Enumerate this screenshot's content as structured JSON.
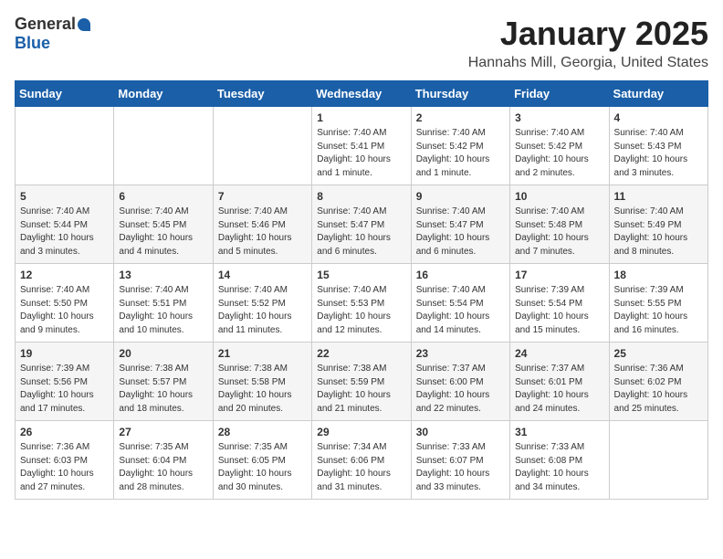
{
  "header": {
    "logo_general": "General",
    "logo_blue": "Blue",
    "title": "January 2025",
    "subtitle": "Hannahs Mill, Georgia, United States"
  },
  "days_of_week": [
    "Sunday",
    "Monday",
    "Tuesday",
    "Wednesday",
    "Thursday",
    "Friday",
    "Saturday"
  ],
  "weeks": [
    [
      {
        "day": "",
        "info": ""
      },
      {
        "day": "",
        "info": ""
      },
      {
        "day": "",
        "info": ""
      },
      {
        "day": "1",
        "info": "Sunrise: 7:40 AM\nSunset: 5:41 PM\nDaylight: 10 hours\nand 1 minute."
      },
      {
        "day": "2",
        "info": "Sunrise: 7:40 AM\nSunset: 5:42 PM\nDaylight: 10 hours\nand 1 minute."
      },
      {
        "day": "3",
        "info": "Sunrise: 7:40 AM\nSunset: 5:42 PM\nDaylight: 10 hours\nand 2 minutes."
      },
      {
        "day": "4",
        "info": "Sunrise: 7:40 AM\nSunset: 5:43 PM\nDaylight: 10 hours\nand 3 minutes."
      }
    ],
    [
      {
        "day": "5",
        "info": "Sunrise: 7:40 AM\nSunset: 5:44 PM\nDaylight: 10 hours\nand 3 minutes."
      },
      {
        "day": "6",
        "info": "Sunrise: 7:40 AM\nSunset: 5:45 PM\nDaylight: 10 hours\nand 4 minutes."
      },
      {
        "day": "7",
        "info": "Sunrise: 7:40 AM\nSunset: 5:46 PM\nDaylight: 10 hours\nand 5 minutes."
      },
      {
        "day": "8",
        "info": "Sunrise: 7:40 AM\nSunset: 5:47 PM\nDaylight: 10 hours\nand 6 minutes."
      },
      {
        "day": "9",
        "info": "Sunrise: 7:40 AM\nSunset: 5:47 PM\nDaylight: 10 hours\nand 6 minutes."
      },
      {
        "day": "10",
        "info": "Sunrise: 7:40 AM\nSunset: 5:48 PM\nDaylight: 10 hours\nand 7 minutes."
      },
      {
        "day": "11",
        "info": "Sunrise: 7:40 AM\nSunset: 5:49 PM\nDaylight: 10 hours\nand 8 minutes."
      }
    ],
    [
      {
        "day": "12",
        "info": "Sunrise: 7:40 AM\nSunset: 5:50 PM\nDaylight: 10 hours\nand 9 minutes."
      },
      {
        "day": "13",
        "info": "Sunrise: 7:40 AM\nSunset: 5:51 PM\nDaylight: 10 hours\nand 10 minutes."
      },
      {
        "day": "14",
        "info": "Sunrise: 7:40 AM\nSunset: 5:52 PM\nDaylight: 10 hours\nand 11 minutes."
      },
      {
        "day": "15",
        "info": "Sunrise: 7:40 AM\nSunset: 5:53 PM\nDaylight: 10 hours\nand 12 minutes."
      },
      {
        "day": "16",
        "info": "Sunrise: 7:40 AM\nSunset: 5:54 PM\nDaylight: 10 hours\nand 14 minutes."
      },
      {
        "day": "17",
        "info": "Sunrise: 7:39 AM\nSunset: 5:54 PM\nDaylight: 10 hours\nand 15 minutes."
      },
      {
        "day": "18",
        "info": "Sunrise: 7:39 AM\nSunset: 5:55 PM\nDaylight: 10 hours\nand 16 minutes."
      }
    ],
    [
      {
        "day": "19",
        "info": "Sunrise: 7:39 AM\nSunset: 5:56 PM\nDaylight: 10 hours\nand 17 minutes."
      },
      {
        "day": "20",
        "info": "Sunrise: 7:38 AM\nSunset: 5:57 PM\nDaylight: 10 hours\nand 18 minutes."
      },
      {
        "day": "21",
        "info": "Sunrise: 7:38 AM\nSunset: 5:58 PM\nDaylight: 10 hours\nand 20 minutes."
      },
      {
        "day": "22",
        "info": "Sunrise: 7:38 AM\nSunset: 5:59 PM\nDaylight: 10 hours\nand 21 minutes."
      },
      {
        "day": "23",
        "info": "Sunrise: 7:37 AM\nSunset: 6:00 PM\nDaylight: 10 hours\nand 22 minutes."
      },
      {
        "day": "24",
        "info": "Sunrise: 7:37 AM\nSunset: 6:01 PM\nDaylight: 10 hours\nand 24 minutes."
      },
      {
        "day": "25",
        "info": "Sunrise: 7:36 AM\nSunset: 6:02 PM\nDaylight: 10 hours\nand 25 minutes."
      }
    ],
    [
      {
        "day": "26",
        "info": "Sunrise: 7:36 AM\nSunset: 6:03 PM\nDaylight: 10 hours\nand 27 minutes."
      },
      {
        "day": "27",
        "info": "Sunrise: 7:35 AM\nSunset: 6:04 PM\nDaylight: 10 hours\nand 28 minutes."
      },
      {
        "day": "28",
        "info": "Sunrise: 7:35 AM\nSunset: 6:05 PM\nDaylight: 10 hours\nand 30 minutes."
      },
      {
        "day": "29",
        "info": "Sunrise: 7:34 AM\nSunset: 6:06 PM\nDaylight: 10 hours\nand 31 minutes."
      },
      {
        "day": "30",
        "info": "Sunrise: 7:33 AM\nSunset: 6:07 PM\nDaylight: 10 hours\nand 33 minutes."
      },
      {
        "day": "31",
        "info": "Sunrise: 7:33 AM\nSunset: 6:08 PM\nDaylight: 10 hours\nand 34 minutes."
      },
      {
        "day": "",
        "info": ""
      }
    ]
  ]
}
